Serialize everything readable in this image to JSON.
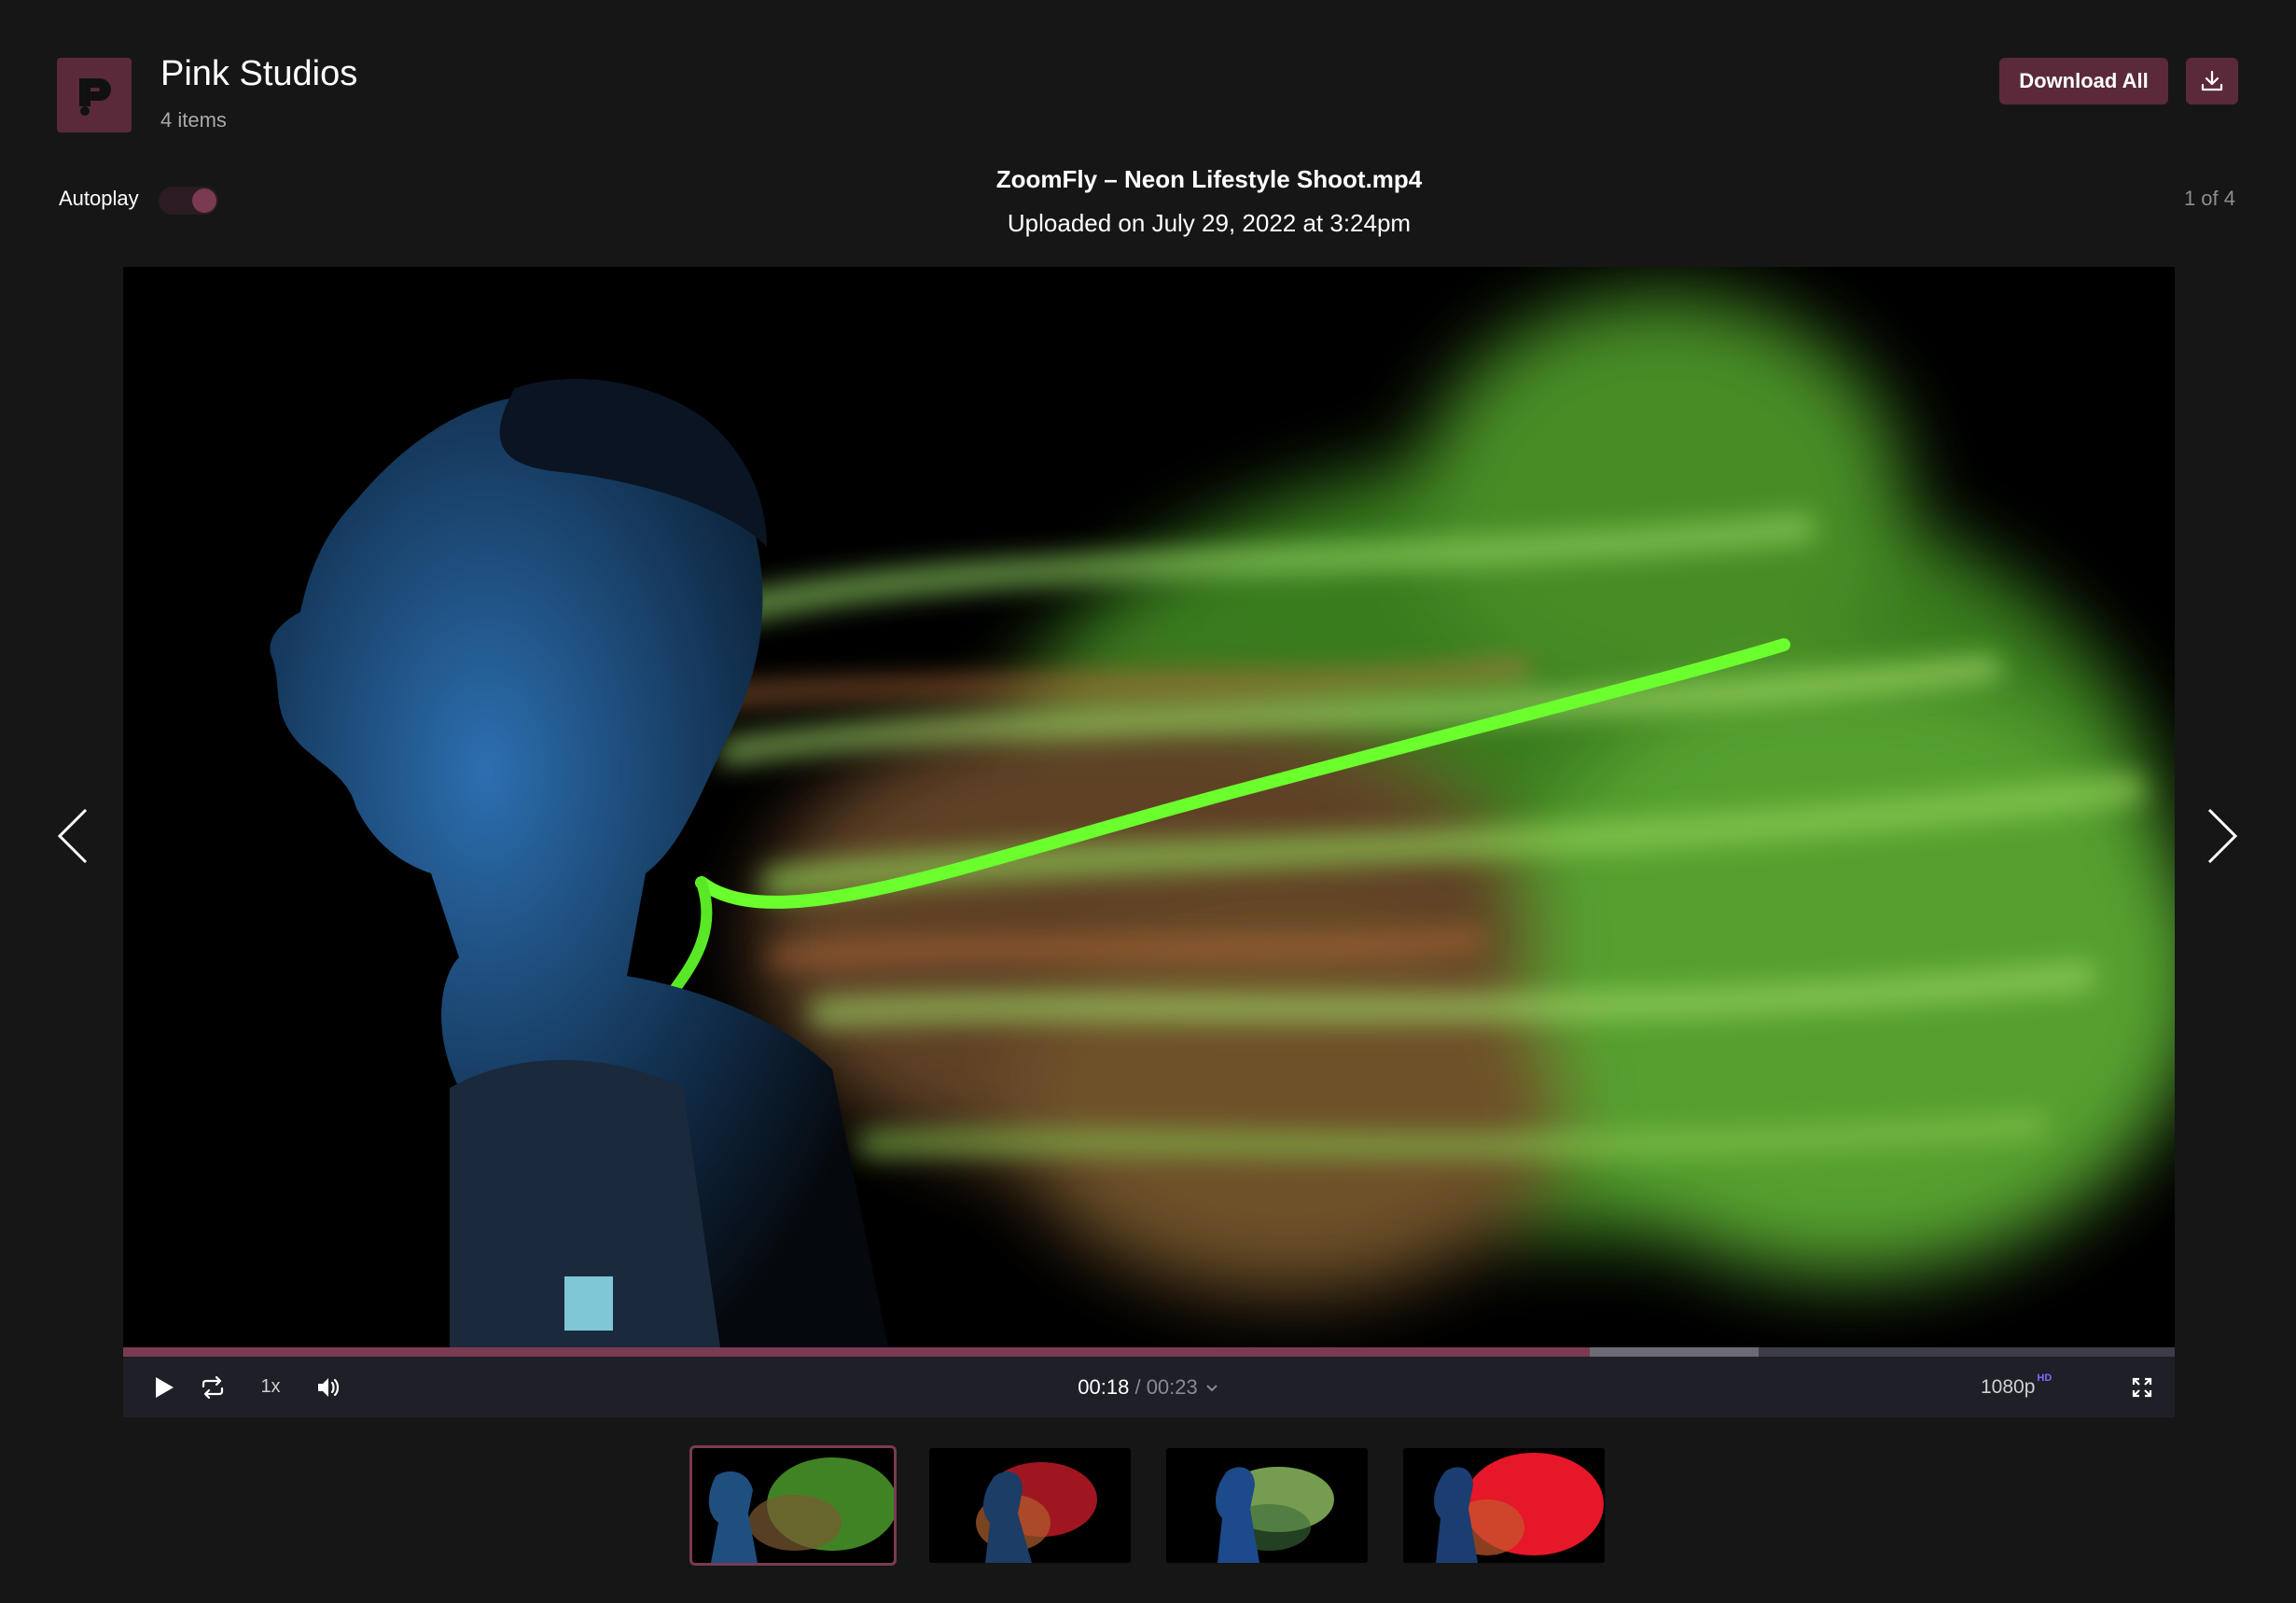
{
  "header": {
    "brand_title": "Pink Studios",
    "item_count": "4 items",
    "download_all_label": "Download All",
    "logo_icon": "p-logo-icon",
    "download_icon": "download-icon"
  },
  "autoplay": {
    "label": "Autoplay",
    "enabled": true
  },
  "file": {
    "name": "ZoomFly – Neon Lifestyle Shoot.mp4",
    "uploaded": "Uploaded on July 29, 2022 at 3:24pm",
    "counter": "1 of 4"
  },
  "player": {
    "current_time": "00:18",
    "separator": "/",
    "total_time": "00:23",
    "speed": "1x",
    "quality": "1080p",
    "quality_badge": "HD",
    "played_fraction": 0.715,
    "buffered_fraction": 0.797
  },
  "thumbnails": [
    {
      "label": "thumbnail-1",
      "active": true,
      "accent": "#5fd13a"
    },
    {
      "label": "thumbnail-2",
      "active": false,
      "accent": "#d81e2c"
    },
    {
      "label": "thumbnail-3",
      "active": false,
      "accent": "#a6d66a"
    },
    {
      "label": "thumbnail-4",
      "active": false,
      "accent": "#ff1a2e"
    }
  ],
  "colors": {
    "background": "#161617",
    "accent": "#5a2a3a",
    "controls_bar": "#1e1f27",
    "progress_played": "#7a3a52"
  }
}
